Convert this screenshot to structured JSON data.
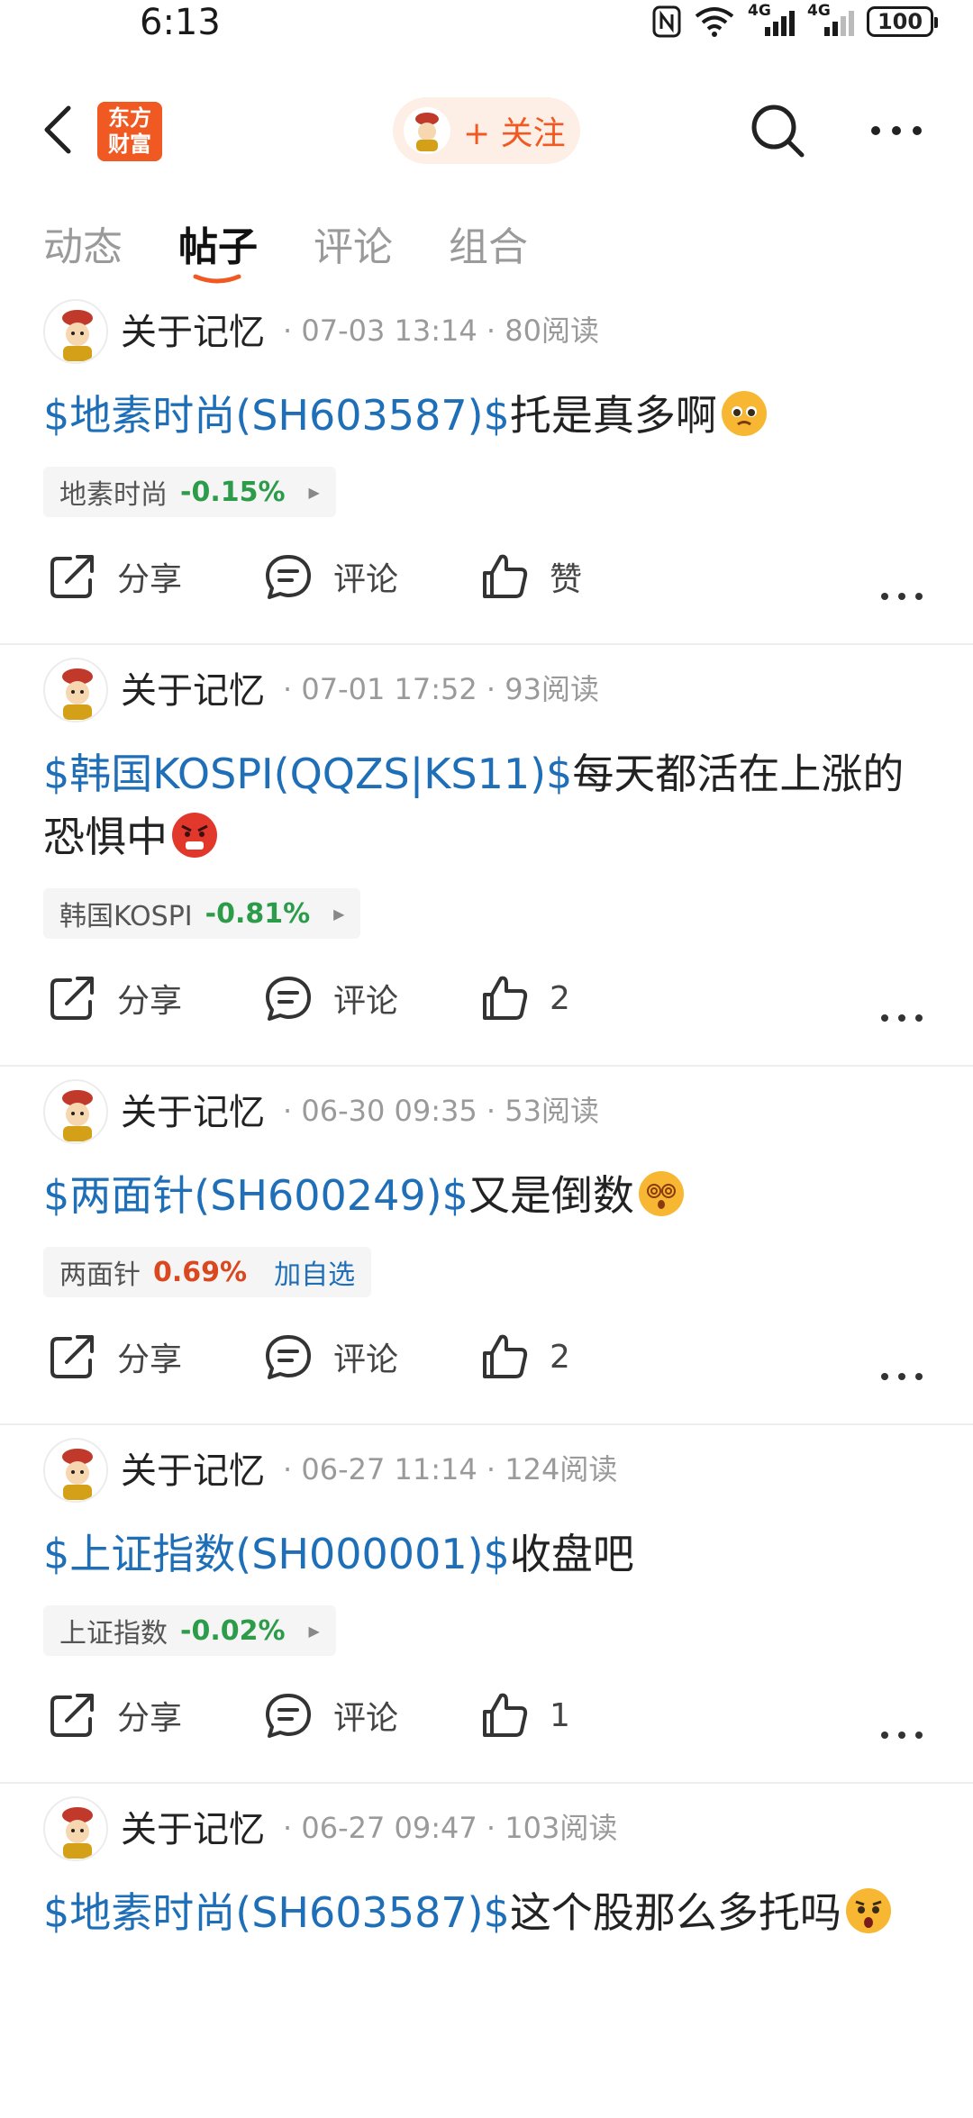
{
  "status_bar": {
    "time": "6:13",
    "network_tags": [
      "4G",
      "4G"
    ],
    "battery": "100"
  },
  "header": {
    "logo_text": "东方财富",
    "follow_label": "+ 关注"
  },
  "tabs": [
    {
      "label": "动态",
      "active": false
    },
    {
      "label": "帖子",
      "active": true
    },
    {
      "label": "评论",
      "active": false
    },
    {
      "label": "组合",
      "active": false
    }
  ],
  "actions": {
    "share_label": "分享",
    "comment_label": "评论",
    "like_default_label": "赞"
  },
  "posts": [
    {
      "user": "关于记忆",
      "meta": "· 07-03 13:14 · 80阅读",
      "stock_link": "$地素时尚(SH603587)$",
      "text": "托是真多啊",
      "emoji": "pleading",
      "quote": {
        "name": "地素时尚",
        "change": "-0.15%",
        "direction": "down",
        "extra": ""
      },
      "likes": "赞"
    },
    {
      "user": "关于记忆",
      "meta": "· 07-01 17:52 · 93阅读",
      "stock_link": "$韩国KOSPI(QQZS|KS11)$",
      "text": "每天都活在上涨的恐惧中",
      "emoji": "angry",
      "quote": {
        "name": "韩国KOSPI",
        "change": "-0.81%",
        "direction": "down",
        "extra": ""
      },
      "likes": "2"
    },
    {
      "user": "关于记忆",
      "meta": "· 06-30 09:35 · 53阅读",
      "stock_link": "$两面针(SH600249)$",
      "text": "又是倒数",
      "emoji": "dizzy",
      "quote": {
        "name": "两面针",
        "change": "0.69%",
        "direction": "up",
        "extra": "加自选"
      },
      "likes": "2"
    },
    {
      "user": "关于记忆",
      "meta": "· 06-27 11:14 · 124阅读",
      "stock_link": "$上证指数(SH000001)$",
      "text": "收盘吧",
      "emoji": "",
      "quote": {
        "name": "上证指数",
        "change": "-0.02%",
        "direction": "down",
        "extra": ""
      },
      "likes": "1"
    },
    {
      "user": "关于记忆",
      "meta": "· 06-27 09:47 · 103阅读",
      "stock_link": "$地素时尚(SH603587)$",
      "text": "这个股那么多托吗",
      "emoji": "shocked",
      "quote": null,
      "likes": ""
    }
  ],
  "colors": {
    "brand_orange": "#f05a22",
    "link_blue": "#1e6fb8",
    "down_green": "#2c9c4a",
    "up_red": "#d9481f"
  }
}
